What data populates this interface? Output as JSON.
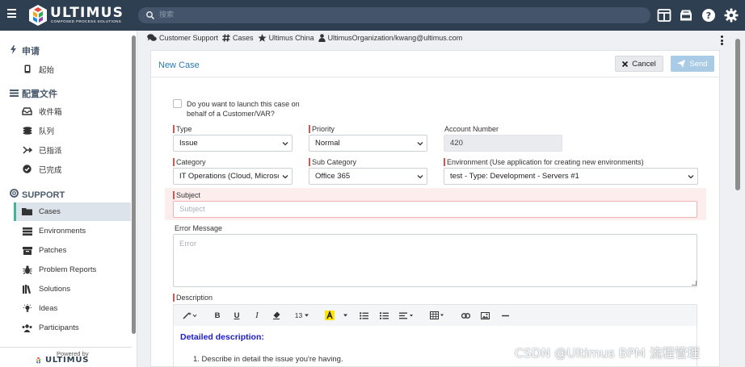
{
  "app": {
    "brand": "ULTIMUS",
    "brand_tagline": "COMPOSED PROCESS SOLUTIONS",
    "search_placeholder": "搜索"
  },
  "icons": {
    "menu": "hamburger-icon",
    "search": "search-icon",
    "layout": "layout-icon",
    "inbox": "inbox-icon",
    "help": "help-icon",
    "settings": "gear-icon"
  },
  "colors": {
    "topbar": "#2f3f52",
    "accent": "#2a7ab8",
    "active_marker": "#3fb59a",
    "required_marker": "#d9534f",
    "send_disabled": "#a9cbe6"
  },
  "sidebar": {
    "section_apply": "申请",
    "item_start": "起始",
    "section_profile": "配置文件",
    "profile_items": [
      "收件箱",
      "队列",
      "已指派",
      "已完成"
    ],
    "section_support": "SUPPORT",
    "support_items": [
      "Cases",
      "Environments",
      "Patches",
      "Problem Reports",
      "Solutions",
      "Ideas",
      "Participants"
    ],
    "active_item": "Cases",
    "powered_by": "Powered by",
    "powered_logo": "ULTIMUS"
  },
  "breadcrumb": {
    "app": "Customer Support",
    "list": "Cases",
    "org": "Ultimus China",
    "user": "UltimusOrganization/kwang@ultimus.com"
  },
  "form": {
    "title": "New Case",
    "cancel_label": "Cancel",
    "send_label": "Send",
    "behalf_label": "Do you want to launch this case on behalf of a Customer/VAR?",
    "behalf_checked": false,
    "type_label": "Type",
    "type_value": "Issue",
    "priority_label": "Priority",
    "priority_value": "Normal",
    "account_label": "Account Number",
    "account_value": "420",
    "category_label": "Category",
    "category_value": "IT Operations (Cloud, Microsoft...",
    "subcategory_label": "Sub Category",
    "subcategory_value": "Office 365",
    "environment_label": "Environment (Use application for creating new environments)",
    "environment_value": "test - Type: Development - Servers #1",
    "subject_label": "Subject",
    "subject_placeholder": "Subject",
    "error_label": "Error Message",
    "error_placeholder": "Error",
    "description_label": "Description",
    "editor": {
      "font_size": "13",
      "bold": "B",
      "underline": "U",
      "italic": "I",
      "heading": "Detailed description:",
      "first_item": "1. Describe in detail the issue you're having."
    }
  },
  "watermark": "CSDN @Ultimus BPM 流程管理"
}
